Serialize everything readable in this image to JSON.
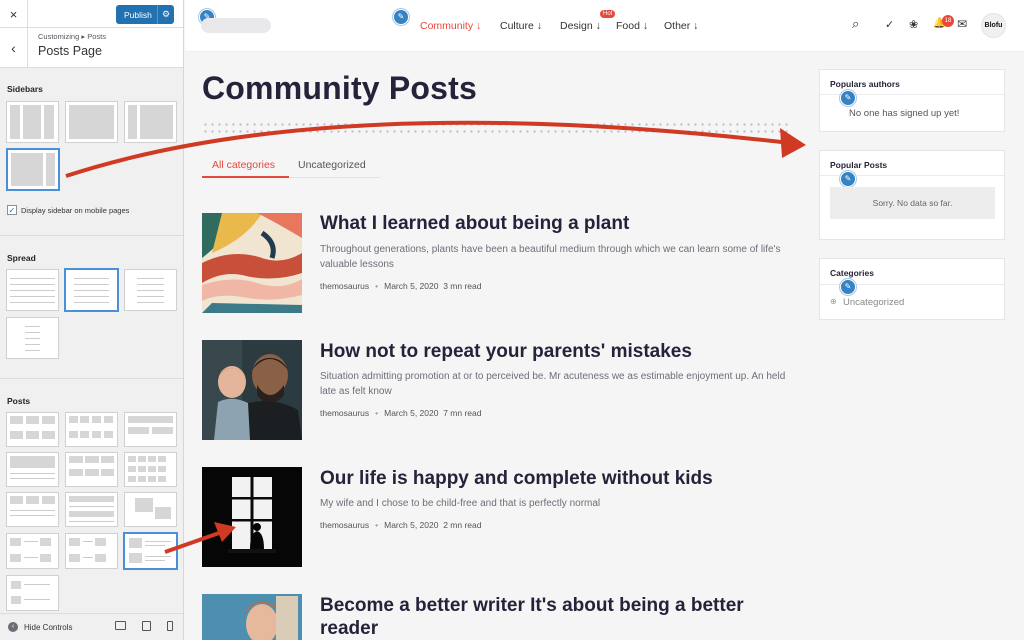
{
  "customizer": {
    "close_label": "×",
    "publish_label": "Publish",
    "gear_glyph": "⚙",
    "back_glyph": "‹",
    "breadcrumb": "Customizing ▸ Posts",
    "title": "Posts Page",
    "sidebars_label": "Sidebars",
    "mobile_sidebar_label": "Display sidebar on mobile pages",
    "mobile_sidebar_checked": true,
    "spread_label": "Spread",
    "posts_label": "Posts",
    "hide_controls_label": "Hide Controls",
    "hide_controls_glyph": "‹"
  },
  "header": {
    "nav": [
      {
        "label": "Community ↓",
        "active": true
      },
      {
        "label": "Culture ↓",
        "active": false
      },
      {
        "label": "Design ↓",
        "active": false
      },
      {
        "label": "Food ↓",
        "active": false
      },
      {
        "label": "Other ↓",
        "active": false
      }
    ],
    "hot_badge": "Hot",
    "notification_count": "18",
    "avatar_text": "Blofu",
    "icons": {
      "search": "⌕",
      "check": "✓",
      "pets": "❀",
      "bell": "🔔",
      "mail": "✉"
    }
  },
  "main": {
    "title": "Community Posts",
    "tabs": [
      "All categories",
      "Uncategorized"
    ],
    "posts": [
      {
        "title": "What I learned about being a plant",
        "excerpt": "Throughout generations, plants have been a beautiful medium through which we can learn some of life's valuable lessons",
        "author": "themosaurus",
        "date": "March 5, 2020",
        "read": "3 mn read"
      },
      {
        "title": "How not to repeat your parents' mistakes",
        "excerpt": "Situation admitting promotion at or to perceived be. Mr acuteness we as estimable enjoyment up. An held late as felt know",
        "author": "themosaurus",
        "date": "March 5, 2020",
        "read": "7 mn read"
      },
      {
        "title": "Our life is happy and complete without kids",
        "excerpt": "My wife and I chose to be child-free and that is perfectly normal",
        "author": "themosaurus",
        "date": "March 5, 2020",
        "read": "2 mn read"
      },
      {
        "title": "Become a better writer It's about being a better reader",
        "excerpt": "",
        "author": "",
        "date": "",
        "read": ""
      }
    ]
  },
  "widgets": {
    "authors_title": "Populars authors",
    "authors_empty": "No one has signed up yet!",
    "popular_title": "Popular Posts",
    "popular_empty": "Sorry. No data so far.",
    "categories_title": "Categories",
    "categories": [
      "Uncategorized"
    ]
  },
  "colors": {
    "accent": "#e8473c",
    "wp_blue": "#2271b1",
    "arrow": "#d03a22",
    "heading": "#25233a"
  }
}
